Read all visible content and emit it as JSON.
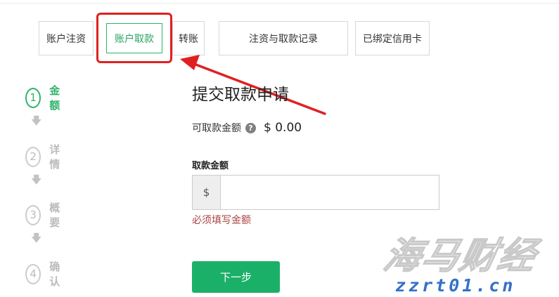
{
  "tabs": [
    {
      "label": "账户注资",
      "active": false
    },
    {
      "label": "账户取款",
      "active": true
    },
    {
      "label": "转账",
      "active": false
    },
    {
      "label": "注资与取款记录",
      "active": false
    },
    {
      "label": "已绑定信用卡",
      "active": false
    }
  ],
  "steps": [
    {
      "number": "1",
      "label": "金额",
      "active": true
    },
    {
      "number": "2",
      "label": "详情",
      "active": false
    },
    {
      "number": "3",
      "label": "概要",
      "active": false
    },
    {
      "number": "4",
      "label": "确认",
      "active": false
    }
  ],
  "step_arrow_glyph": "🡇",
  "form": {
    "title": "提交取款申请",
    "balance_label": "可取款金额",
    "balance_value": "$ 0.00",
    "help_glyph": "?",
    "amount_label": "取款金额",
    "currency_addon": "$",
    "amount_value": "",
    "error": "必须填写金额",
    "next_button": "下一步"
  },
  "watermark": {
    "title": "海马财经",
    "url": "zzrt01.cn"
  },
  "colors": {
    "accent_green": "#1bb068",
    "annotation_red": "#e02020",
    "error_red": "#a94442",
    "watermark_blue": "#3570c8"
  }
}
